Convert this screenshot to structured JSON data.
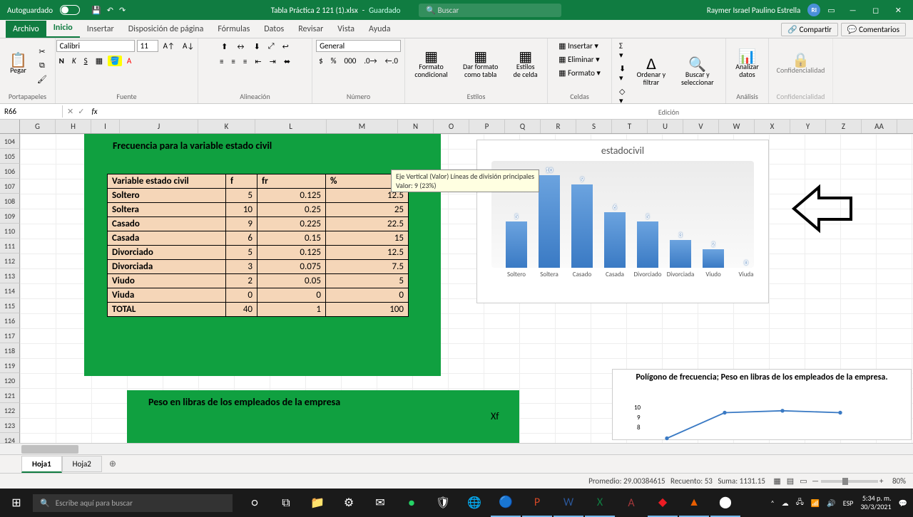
{
  "titlebar": {
    "autosave": "Autoguardado",
    "filename": "Tabla Práctica 2 121 (1).xlsx",
    "saved_status": "Guardado",
    "search_placeholder": "Buscar",
    "user_name": "Raymer Israel Paulino Estrella",
    "user_initials": "RI"
  },
  "tabs": {
    "file": "Archivo",
    "home": "Inicio",
    "insert": "Insertar",
    "layout": "Disposición de página",
    "formulas": "Fórmulas",
    "data": "Datos",
    "review": "Revisar",
    "view": "Vista",
    "help": "Ayuda",
    "share": "Compartir",
    "comments": "Comentarios"
  },
  "ribbon": {
    "paste": "Pegar",
    "clipboard": "Portapapeles",
    "font_name": "Calibri",
    "font_size": "11",
    "font_group": "Fuente",
    "align_group": "Alineación",
    "number_format": "General",
    "number_group": "Número",
    "cond_format": "Formato condicional",
    "table_format": "Dar formato como tabla",
    "cell_styles": "Estilos de celda",
    "styles_group": "Estilos",
    "insert_btn": "Insertar",
    "delete_btn": "Eliminar",
    "format_btn": "Formato",
    "cells_group": "Celdas",
    "sort_filter": "Ordenar y filtrar",
    "find_select": "Buscar y seleccionar",
    "edit_group": "Edición",
    "analyze": "Analizar datos",
    "analysis_group": "Análisis",
    "confidentiality": "Confidencialidad",
    "conf_group": "Confidencialidad"
  },
  "namebox": "R66",
  "row_start": 104,
  "sheet": {
    "title1": "Frecuencia para la variable estado civil",
    "title2": "Peso en libras de los empleados de la empresa",
    "xf_label": "Xf",
    "headers": [
      "Variable estado civil",
      "f",
      "fr",
      "%"
    ],
    "rows": [
      [
        "Soltero",
        "5",
        "0.125",
        "12.5"
      ],
      [
        "Soltera",
        "10",
        "0.25",
        "25"
      ],
      [
        "Casado",
        "9",
        "0.225",
        "22.5"
      ],
      [
        "Casada",
        "6",
        "0.15",
        "15"
      ],
      [
        "Divorciado",
        "5",
        "0.125",
        "12.5"
      ],
      [
        "Divorciada",
        "3",
        "0.075",
        "7.5"
      ],
      [
        "Viudo",
        "2",
        "0.05",
        "5"
      ],
      [
        "Viuda",
        "0",
        "0",
        "0"
      ],
      [
        "TOTAL",
        "40",
        "1",
        "100"
      ]
    ],
    "tooltip_line1": "Eje Vertical (Valor)  Líneas de división principales",
    "tooltip_line2": "Valor: 9 (23%)"
  },
  "chart_data": {
    "type": "bar",
    "title": "estadocivil",
    "categories": [
      "Soltero",
      "Soltera",
      "Casado",
      "Casada",
      "Divorciado",
      "Divorciada",
      "Viudo",
      "Viuda"
    ],
    "values": [
      5,
      10,
      9,
      6,
      5,
      3,
      2,
      0
    ],
    "ylim": [
      0,
      10
    ],
    "secondary": {
      "type": "line",
      "title": "Polígono de frecuencia; Peso en libras de los empleados de la empresa.",
      "y_ticks": [
        8,
        9,
        10
      ]
    }
  },
  "sheet_tabs": {
    "s1": "Hoja1",
    "s2": "Hoja2"
  },
  "statusbar": {
    "avg_label": "Promedio:",
    "avg": "29.00384615",
    "count_label": "Recuento:",
    "count": "53",
    "sum_label": "Suma:",
    "sum": "1131.15",
    "zoom": "80%"
  },
  "taskbar": {
    "search": "Escribe aquí para buscar",
    "lang": "ESP",
    "time": "5:34 p. m.",
    "date": "30/3/2021"
  }
}
